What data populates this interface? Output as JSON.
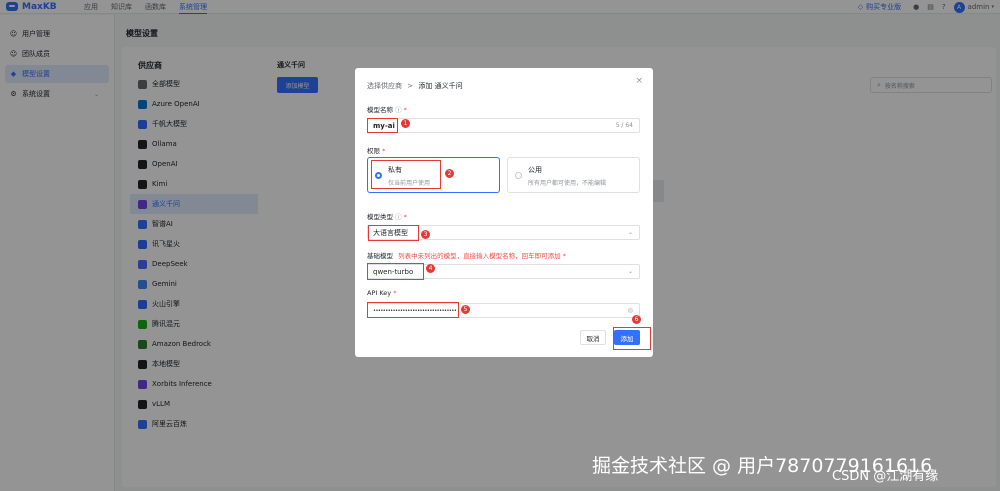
{
  "app": {
    "name": "MaxKB"
  },
  "topnav": [
    {
      "label": "应用",
      "active": false
    },
    {
      "label": "知识库",
      "active": false
    },
    {
      "label": "函数库",
      "active": false
    },
    {
      "label": "系统管理",
      "active": true
    }
  ],
  "topright": {
    "promo": "购买专业版",
    "user": "admin",
    "avatar_letter": "A"
  },
  "sidebar": [
    {
      "label": "用户管理",
      "icon": "user-icon",
      "active": false
    },
    {
      "label": "团队成员",
      "icon": "team-icon",
      "active": false
    },
    {
      "label": "模型设置",
      "icon": "cube-icon",
      "active": true
    },
    {
      "label": "系统设置",
      "icon": "gear-icon",
      "active": false,
      "expandable": true
    }
  ],
  "page": {
    "title": "模型设置"
  },
  "providers": {
    "title": "供应商",
    "items": [
      {
        "label": "全部模型",
        "icon": "grid-icon",
        "color": "#646a73"
      },
      {
        "label": "Azure OpenAI",
        "icon": "azure-icon",
        "color": "#0078d4"
      },
      {
        "label": "千帆大模型",
        "icon": "qianfan-icon",
        "color": "#2f6bff"
      },
      {
        "label": "Ollama",
        "icon": "ollama-icon",
        "color": "#1f2329"
      },
      {
        "label": "OpenAI",
        "icon": "openai-icon",
        "color": "#1f2329"
      },
      {
        "label": "Kimi",
        "icon": "kimi-icon",
        "color": "#1f2329"
      },
      {
        "label": "通义千问",
        "icon": "tongyi-icon",
        "color": "#6e45e2",
        "active": true
      },
      {
        "label": "智谱AI",
        "icon": "zhipu-icon",
        "color": "#3370ff"
      },
      {
        "label": "讯飞星火",
        "icon": "spark-icon",
        "color": "#2f6bff"
      },
      {
        "label": "DeepSeek",
        "icon": "deepseek-icon",
        "color": "#4d6bfe"
      },
      {
        "label": "Gemini",
        "icon": "gemini-icon",
        "color": "#4285f4"
      },
      {
        "label": "火山引擎",
        "icon": "volcano-icon",
        "color": "#2f6bff"
      },
      {
        "label": "腾讯混元",
        "icon": "hunyuan-icon",
        "color": "#1aad19"
      },
      {
        "label": "Amazon Bedrock",
        "icon": "bedrock-icon",
        "color": "#2e7d32"
      },
      {
        "label": "本地模型",
        "icon": "local-icon",
        "color": "#1f2329"
      },
      {
        "label": "Xorbits Inference",
        "icon": "xinference-icon",
        "color": "#6e45e2"
      },
      {
        "label": "vLLM",
        "icon": "vllm-icon",
        "color": "#1f2329"
      },
      {
        "label": "阿里云百炼",
        "icon": "bailian-icon",
        "color": "#3370ff"
      }
    ]
  },
  "models": {
    "heading": "通义千问",
    "add_button": "添加模型",
    "search_placeholder": "按名称搜索"
  },
  "modal": {
    "breadcrumb_prev": "选择供应商",
    "breadcrumb_sep": ">",
    "breadcrumb_current": "添加 通义千问",
    "name_label": "模型名称",
    "name_value": "my-ai",
    "name_count": "5 / 64",
    "perm_label": "权限",
    "perm_options": [
      {
        "title": "私有",
        "desc": "仅当前用户使用",
        "selected": true
      },
      {
        "title": "公用",
        "desc": "所有用户都可使用，不能编辑",
        "selected": false
      }
    ],
    "type_label": "模型类型",
    "type_value": "大语言模型",
    "base_label": "基础模型",
    "base_hint": "列表中未列出的模型，直接输入模型名称，回车即可添加",
    "base_value": "qwen-turbo",
    "apikey_label": "API Key",
    "apikey_value": "••••••••••••••••••••••••••••••••••",
    "cancel": "取消",
    "submit": "添加"
  },
  "annotations": [
    "1",
    "2",
    "3",
    "4",
    "5",
    "6"
  ],
  "watermark": {
    "line1": "掘金技术社区 @ 用户7870779161616",
    "line2": "CSDN @江湖有缘"
  },
  "colors": {
    "accent": "#3370ff",
    "annotation": "#e53935",
    "required": "#f54a45"
  }
}
